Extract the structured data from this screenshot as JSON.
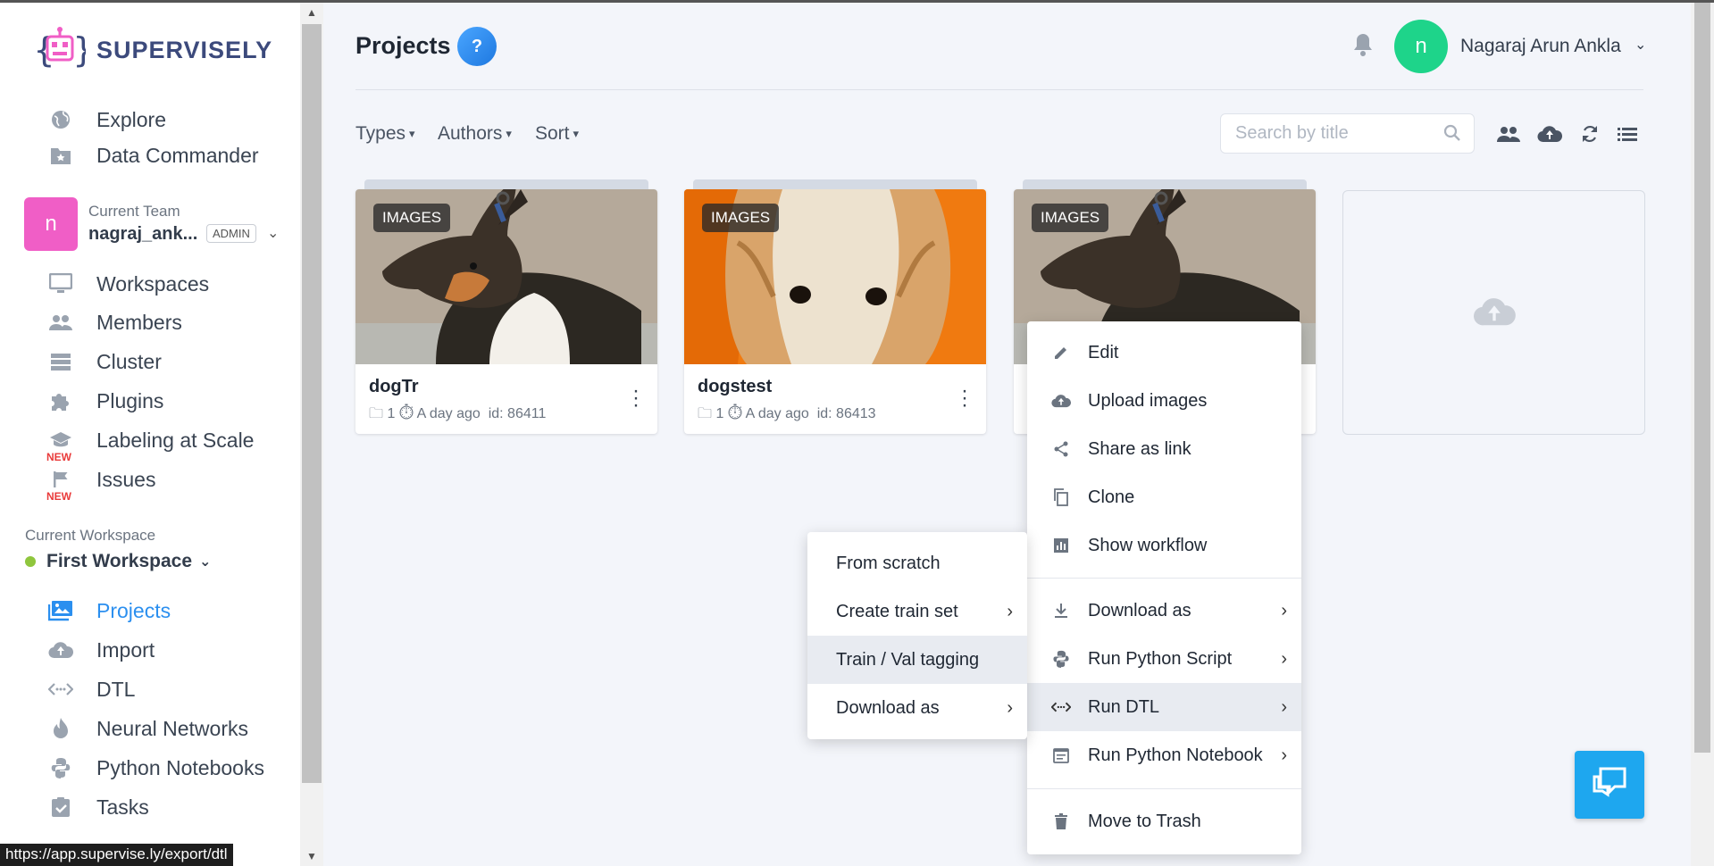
{
  "app": {
    "brand": "SUPERVISELY"
  },
  "sidebar": {
    "top_items": [
      {
        "label": "Explore",
        "icon": "globe-icon"
      },
      {
        "label": "Data Commander",
        "icon": "folder-star-icon"
      }
    ],
    "team": {
      "avatar_letter": "n",
      "label": "Current Team",
      "name": "nagraj_ank...",
      "role": "ADMIN"
    },
    "team_items": [
      {
        "label": "Workspaces",
        "icon": "monitor-icon"
      },
      {
        "label": "Members",
        "icon": "people-icon"
      },
      {
        "label": "Cluster",
        "icon": "server-icon"
      },
      {
        "label": "Plugins",
        "icon": "puzzle-icon"
      },
      {
        "label": "Labeling at Scale",
        "icon": "graduation-icon",
        "badge": "NEW"
      },
      {
        "label": "Issues",
        "icon": "flag-icon",
        "badge": "NEW"
      }
    ],
    "workspace": {
      "label": "Current Workspace",
      "name": "First Workspace"
    },
    "workspace_items": [
      {
        "label": "Projects",
        "icon": "images-icon",
        "active": true
      },
      {
        "label": "Import",
        "icon": "cloud-upload-icon"
      },
      {
        "label": "DTL",
        "icon": "code-arrows-icon"
      },
      {
        "label": "Neural Networks",
        "icon": "flame-icon"
      },
      {
        "label": "Python Notebooks",
        "icon": "python-icon"
      },
      {
        "label": "Tasks",
        "icon": "clipboard-check-icon"
      }
    ]
  },
  "status_bar": {
    "url": "https://app.supervise.ly/export/dtl"
  },
  "header": {
    "title": "Projects",
    "help": "?",
    "user": {
      "avatar_letter": "n",
      "name": "Nagaraj Arun Ankla"
    }
  },
  "filters": {
    "types": "Types",
    "authors": "Authors",
    "sort": "Sort"
  },
  "search": {
    "placeholder": "Search by title",
    "value": ""
  },
  "projects": [
    {
      "badge": "IMAGES",
      "name": "dogTr",
      "datasets": "1",
      "time": "A day ago",
      "id": "id: 86411"
    },
    {
      "badge": "IMAGES",
      "name": "dogstest",
      "datasets": "1",
      "time": "A day ago",
      "id": "id: 86413"
    },
    {
      "badge": "IMAGES",
      "name": "",
      "datasets": "",
      "time": "",
      "id": ""
    }
  ],
  "context_menu": {
    "items": [
      {
        "label": "Edit",
        "icon": "pencil-icon"
      },
      {
        "label": "Upload images",
        "icon": "cloud-upload-icon"
      },
      {
        "label": "Share as link",
        "icon": "share-icon"
      },
      {
        "label": "Clone",
        "icon": "copy-icon"
      },
      {
        "label": "Show workflow",
        "icon": "chart-icon"
      },
      {
        "label": "Download as",
        "icon": "download-icon",
        "submenu": true
      },
      {
        "label": "Run Python Script",
        "icon": "python-icon",
        "submenu": true
      },
      {
        "label": "Run DTL",
        "icon": "code-arrows-icon",
        "submenu": true,
        "highlighted": true
      },
      {
        "label": "Run Python Notebook",
        "icon": "notebook-icon",
        "submenu": true
      },
      {
        "label": "Move to Trash",
        "icon": "trash-icon"
      }
    ]
  },
  "sub_menu": {
    "items": [
      {
        "label": "From scratch"
      },
      {
        "label": "Create train set",
        "submenu": true
      },
      {
        "label": "Train / Val tagging",
        "highlighted": true
      },
      {
        "label": "Download as",
        "submenu": true
      }
    ]
  },
  "colors": {
    "accent": "#2b8fef",
    "team_avatar": "#f05ec6",
    "user_avatar": "#1ed48a",
    "chat": "#1ea7ef",
    "new_badge": "#e93b3b"
  }
}
